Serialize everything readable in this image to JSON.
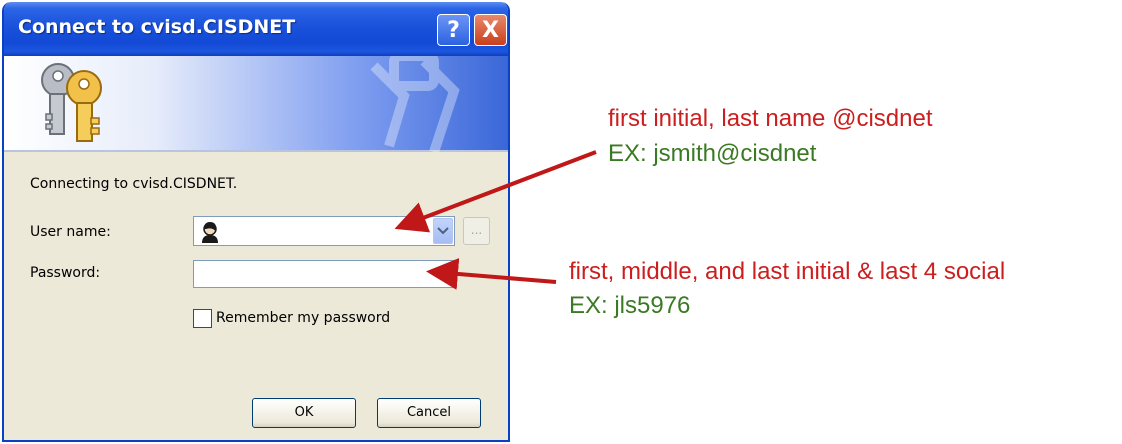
{
  "window": {
    "title": "Connect to cvisd.CISDNET",
    "help_symbol": "?",
    "close_symbol": "X"
  },
  "icons": {
    "banner": "keys-icon",
    "user": "user-icon",
    "dropdown": "chevron-down-icon"
  },
  "dialog": {
    "connecting_text": "Connecting to cvisd.CISDNET.",
    "username_label": "User name:",
    "username_value": "",
    "browse_label": "...",
    "password_label": "Password:",
    "password_value": "",
    "remember_label": "Remember my password",
    "remember_checked": false,
    "ok_label": "OK",
    "cancel_label": "Cancel"
  },
  "annotations": {
    "username_hint": "first initial, last name @cisdnet",
    "username_example": "EX: jsmith@cisdnet",
    "password_hint": "first, middle, and last initial  & last 4 social",
    "password_example": "EX: jls5976"
  },
  "colors": {
    "title_bar": "#1a52db",
    "dialog_bg": "#ece9d8",
    "annotation_red": "#cc1e1e",
    "annotation_green": "#3b7a24",
    "arrow": "#c01818"
  }
}
